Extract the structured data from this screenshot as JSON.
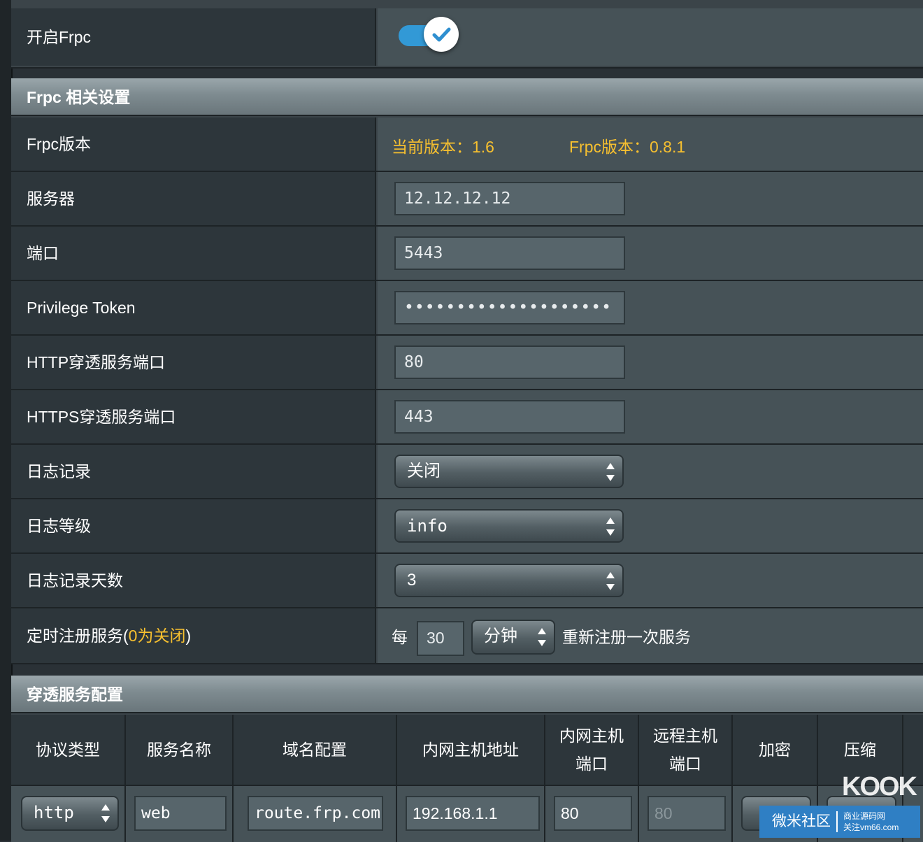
{
  "enable": {
    "label": "开启Frpc",
    "enabled": true
  },
  "settings": {
    "title": "Frpc 相关设置",
    "version_label": "Frpc版本",
    "current_version": "当前版本：1.6",
    "frpc_version": "Frpc版本：0.8.1",
    "server_label": "服务器",
    "server_value": "12.12.12.12",
    "port_label": "端口",
    "port_value": "5443",
    "token_label": "Privilege Token",
    "token_value": "••••••••••••••••••••",
    "http_label": "HTTP穿透服务端口",
    "http_value": "80",
    "https_label": "HTTPS穿透服务端口",
    "https_value": "443",
    "log_label": "日志记录",
    "log_value": "关闭",
    "loglevel_label": "日志等级",
    "loglevel_value": "info",
    "logdays_label": "日志记录天数",
    "logdays_value": "3",
    "timer_label_prefix": "定时注册服务(",
    "timer_label_highlight": "0为关闭",
    "timer_label_suffix": ")",
    "timer_every": "每",
    "timer_value": "30",
    "timer_unit": "分钟",
    "timer_suffix": "重新注册一次服务"
  },
  "services": {
    "title": "穿透服务配置",
    "headers": [
      "协议类型",
      "服务名称",
      "域名配置",
      "内网主机地址",
      "内网主机\n端口",
      "远程主机\n端口",
      "加密",
      "压缩"
    ],
    "row": {
      "protocol": "http",
      "name": "web",
      "domain": "route.frp.com",
      "local_ip": "192.168.1.1",
      "local_port": "80",
      "remote_port": "80"
    }
  },
  "watermark": {
    "brand": "微米社区",
    "line1": "商业源码网",
    "line2": "关注vm66.com",
    "logo": "KOOK"
  },
  "colors": {
    "accent": "#3299d6",
    "highlight": "#f7c02f",
    "header": "#8693a0"
  }
}
